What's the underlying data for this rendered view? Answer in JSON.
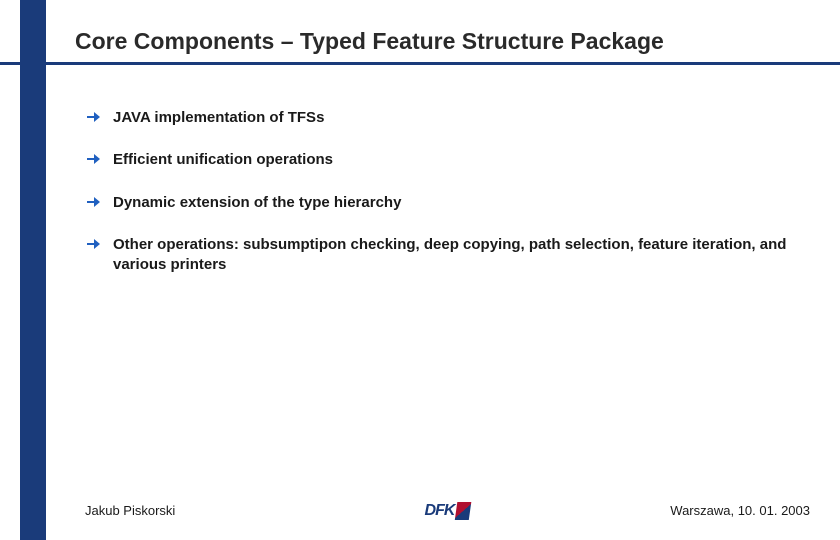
{
  "title": "Core Components – Typed Feature Structure Package",
  "bullets": [
    "JAVA implementation of TFSs",
    "Efficient unification operations",
    "Dynamic extension of the type hierarchy",
    "Other operations: subsumptipon checking, deep copying, path selection, feature iteration, and various printers"
  ],
  "footer": {
    "author": "Jakub Piskorski",
    "logo": "DFK",
    "location_date": "Warszawa, 10. 01. 2003"
  },
  "colors": {
    "accent": "#1a3b7a",
    "arrow": "#2060c0"
  }
}
